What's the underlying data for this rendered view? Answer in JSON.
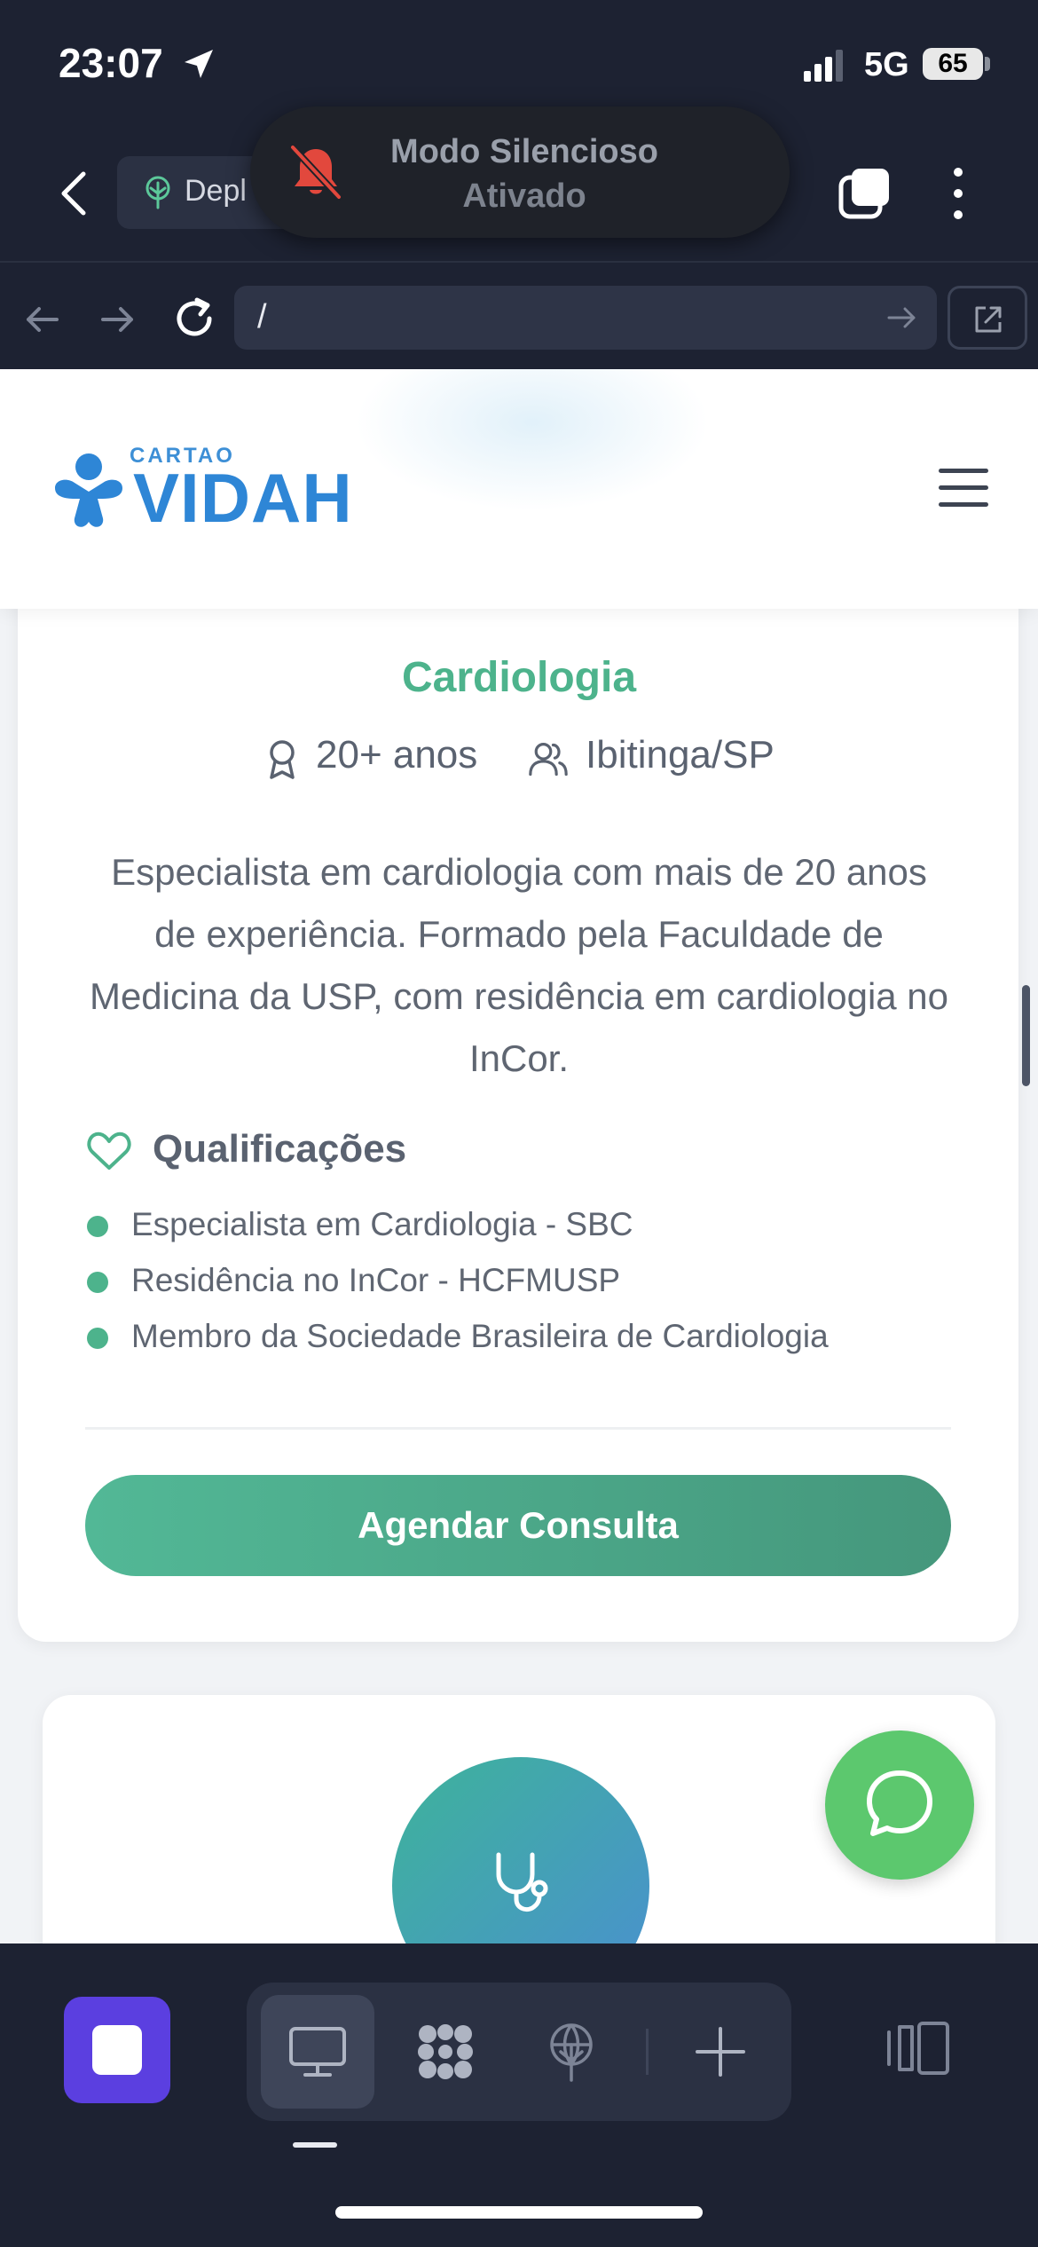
{
  "status_bar": {
    "time": "23:07",
    "network": "5G",
    "battery": "65"
  },
  "browser": {
    "tab_label": "Depl",
    "url": "/",
    "toast": {
      "title": "Modo Silencioso",
      "subtitle": "Ativado"
    }
  },
  "site": {
    "logo_small": "CARTAO",
    "logo_big": "VIDAH"
  },
  "doctor_card": {
    "specialty": "Cardiologia",
    "experience": "20+ anos",
    "location": "Ibitinga/SP",
    "bio": "Especialista em cardiologia com mais de 20 anos de experiência. Formado pela Faculdade de Medicina da USP, com residência em cardiologia no InCor.",
    "qualifications_title": "Qualificações",
    "qualifications": [
      "Especialista em Cardiologia - SBC",
      "Residência no InCor - HCFMUSP",
      "Membro da Sociedade Brasileira de Cardiologia"
    ],
    "cta_label": "Agendar Consulta"
  },
  "colors": {
    "accent_green": "#4db38c",
    "brand_blue": "#2e86d6",
    "whatsapp_green": "#5cc86e",
    "browser_bg": "#1d2232",
    "app_purple": "#5b3fe0"
  },
  "icons": {
    "status": [
      "location-arrow-icon",
      "signal-icon"
    ],
    "browser": [
      "back-chevron-icon",
      "tree-icon",
      "bell-slash-icon",
      "tabs-icon",
      "kebab-icon",
      "nav-back-icon",
      "nav-forward-icon",
      "reload-icon",
      "go-arrow-icon",
      "external-link-icon"
    ],
    "page": [
      "hamburger-icon",
      "award-icon",
      "users-icon",
      "heart-icon",
      "stethoscope-icon",
      "whatsapp-chat-icon"
    ],
    "toolbar": [
      "desktop-icon",
      "grid-blob-icon",
      "globe-tree-icon",
      "plus-icon",
      "split-view-icon"
    ]
  }
}
